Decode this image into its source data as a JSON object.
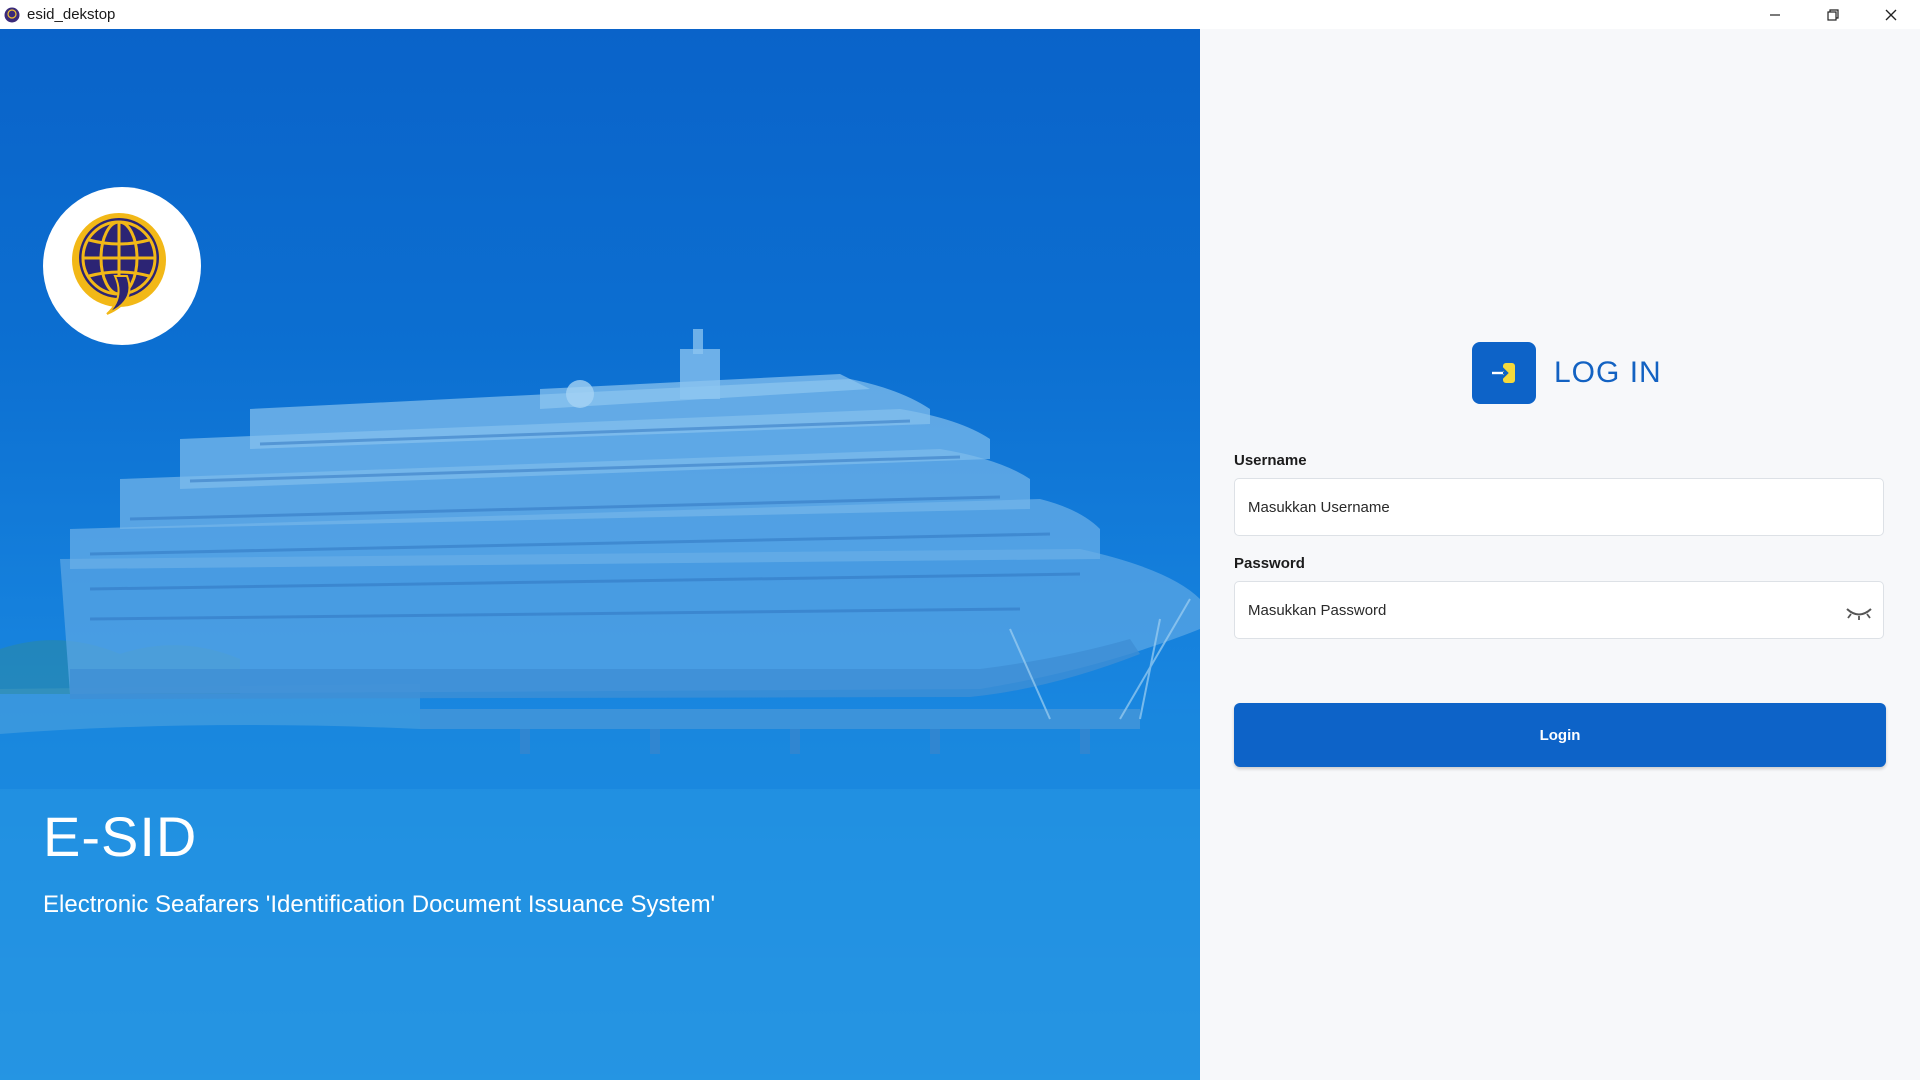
{
  "window": {
    "title": "esid_dekstop",
    "minimize_icon": "minimize-icon",
    "maximize_icon": "restore-icon",
    "close_icon": "close-icon"
  },
  "hero": {
    "logo_icon": "globe-emblem-icon",
    "title": "E-SID",
    "subtitle": "Electronic Seafarers 'Identification Document Issuance System'",
    "overlay_color": "#0a63c9"
  },
  "login": {
    "heading_icon": "login-arrow-icon",
    "heading": "LOG IN",
    "username": {
      "label": "Username",
      "placeholder": "Masukkan Username",
      "value": ""
    },
    "password": {
      "label": "Password",
      "placeholder": "Masukkan Password",
      "value": "",
      "toggle_icon": "eye-closed-icon"
    },
    "submit_label": "Login"
  },
  "colors": {
    "accent": "#0d63c8",
    "heading_text": "#1362c2",
    "icon_yellow": "#f5d93a"
  }
}
